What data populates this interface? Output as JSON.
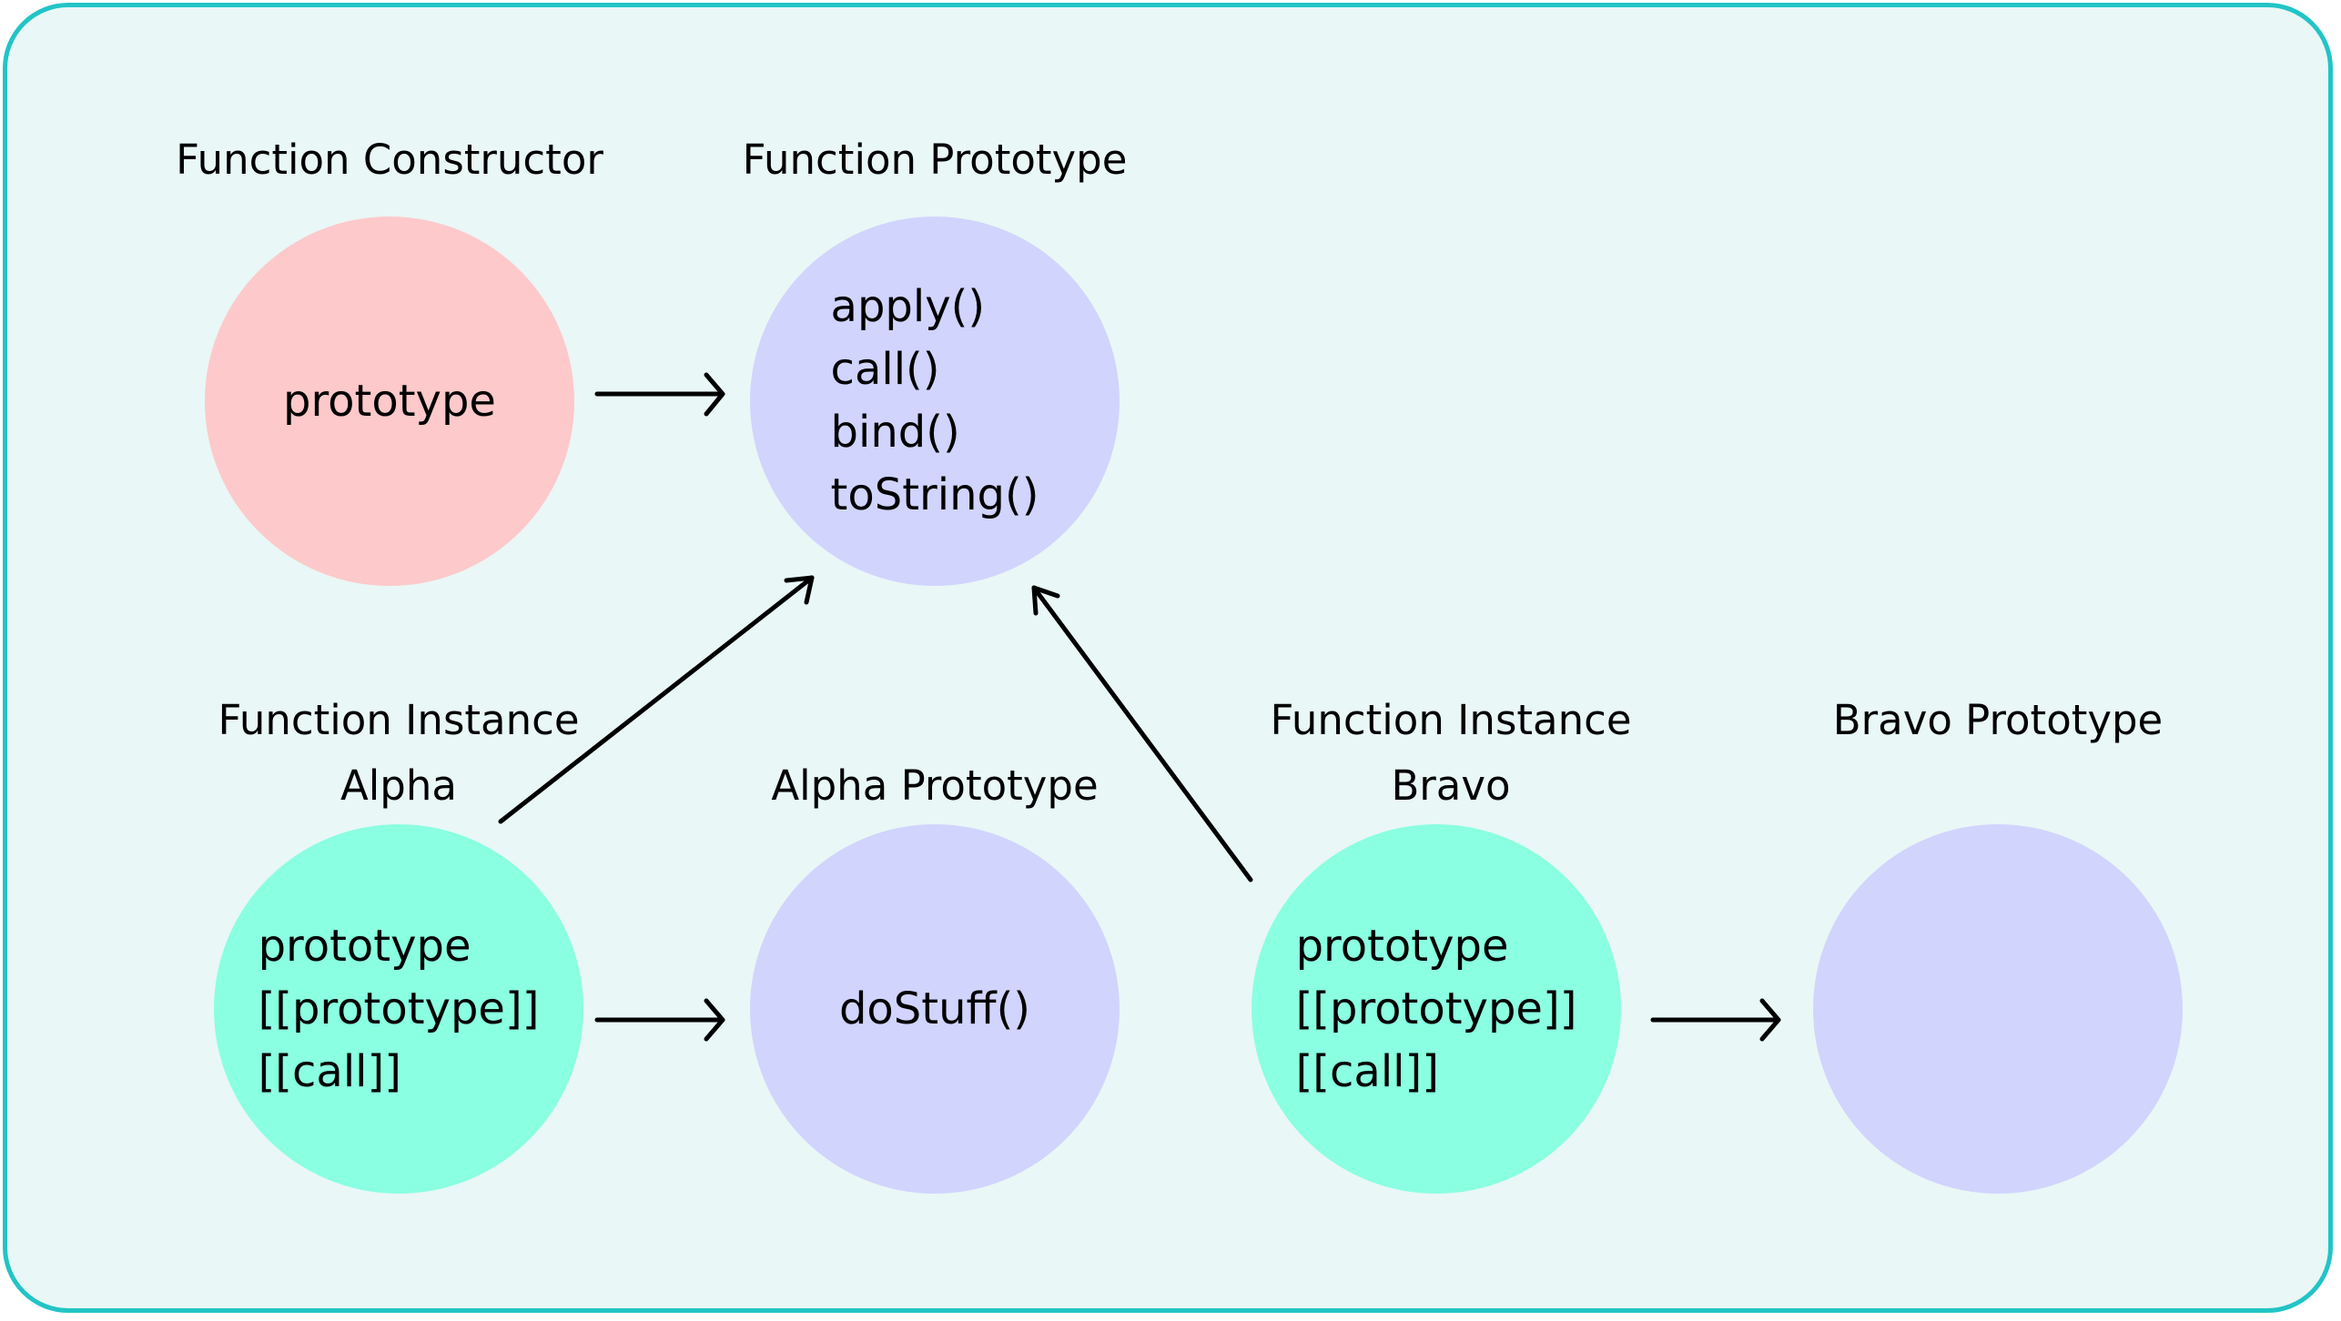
{
  "diagram": {
    "nodes": [
      {
        "id": "function-constructor",
        "title": [
          "Function Constructor"
        ],
        "contents": [
          "prototype"
        ],
        "color": "#fdc9ca"
      },
      {
        "id": "function-prototype",
        "title": [
          "Function Prototype"
        ],
        "contents": [
          "apply()",
          "call()",
          "bind()",
          "toString()"
        ],
        "color": "#d1d4fd"
      },
      {
        "id": "function-instance-alpha",
        "title": [
          "Function Instance",
          "Alpha"
        ],
        "contents": [
          "prototype",
          "[[prototype]]",
          "[[call]]"
        ],
        "color": "#8affe1"
      },
      {
        "id": "alpha-prototype",
        "title": [
          "Alpha Prototype"
        ],
        "contents": [
          "doStuff()"
        ],
        "color": "#d1d4fd"
      },
      {
        "id": "function-instance-bravo",
        "title": [
          "Function Instance",
          "Bravo"
        ],
        "contents": [
          "prototype",
          "[[prototype]]",
          "[[call]]"
        ],
        "color": "#8affe1"
      },
      {
        "id": "bravo-prototype",
        "title": [
          "Bravo Prototype"
        ],
        "contents": [],
        "color": "#d1d4fd"
      }
    ],
    "edges": [
      {
        "from": "function-constructor",
        "to": "function-prototype"
      },
      {
        "from": "function-instance-alpha",
        "to": "function-prototype"
      },
      {
        "from": "function-instance-alpha",
        "to": "alpha-prototype"
      },
      {
        "from": "function-instance-bravo",
        "to": "function-prototype"
      },
      {
        "from": "function-instance-bravo",
        "to": "bravo-prototype"
      }
    ],
    "colors": {
      "border": "#22c4c6",
      "background": "#e9f7f6",
      "arrow": "#000000"
    }
  }
}
